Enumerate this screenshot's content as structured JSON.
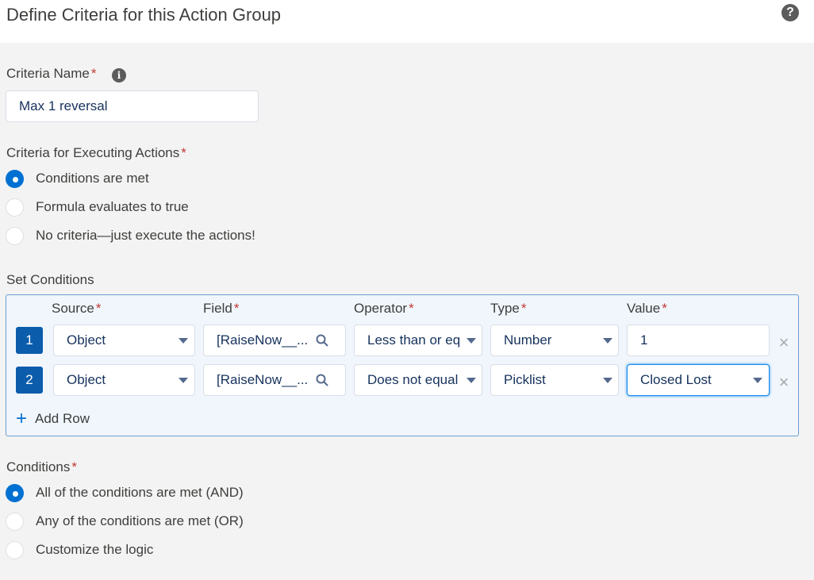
{
  "header": {
    "title": "Define Criteria for this Action Group",
    "help_icon": "question-circle-icon"
  },
  "criteria_name": {
    "label": "Criteria Name",
    "required": "*",
    "value": "Max 1 reversal"
  },
  "criteria_execution": {
    "label": "Criteria for Executing Actions",
    "required": "*",
    "options": [
      {
        "label": "Conditions are met",
        "checked": true
      },
      {
        "label": "Formula evaluates to true",
        "checked": false
      },
      {
        "label": "No criteria—just execute the actions!",
        "checked": false
      }
    ]
  },
  "set_conditions": {
    "label": "Set Conditions",
    "columns": [
      "Source",
      "Field",
      "Operator",
      "Type",
      "Value"
    ],
    "required": "*",
    "rows": [
      {
        "num": "1",
        "source": "Object",
        "field": "[RaiseNow__...",
        "operator": "Less than or eq",
        "type": "Number",
        "value": "1"
      },
      {
        "num": "2",
        "source": "Object",
        "field": "[RaiseNow__...",
        "operator": "Does not equal",
        "type": "Picklist",
        "value": "Closed Lost"
      }
    ],
    "add_row": "Add Row"
  },
  "conditions_logic": {
    "label": "Conditions",
    "required": "*",
    "options": [
      {
        "label": "All of the conditions are met (AND)",
        "checked": true
      },
      {
        "label": "Any of the conditions are met (OR)",
        "checked": false
      },
      {
        "label": "Customize the logic",
        "checked": false
      }
    ]
  }
}
